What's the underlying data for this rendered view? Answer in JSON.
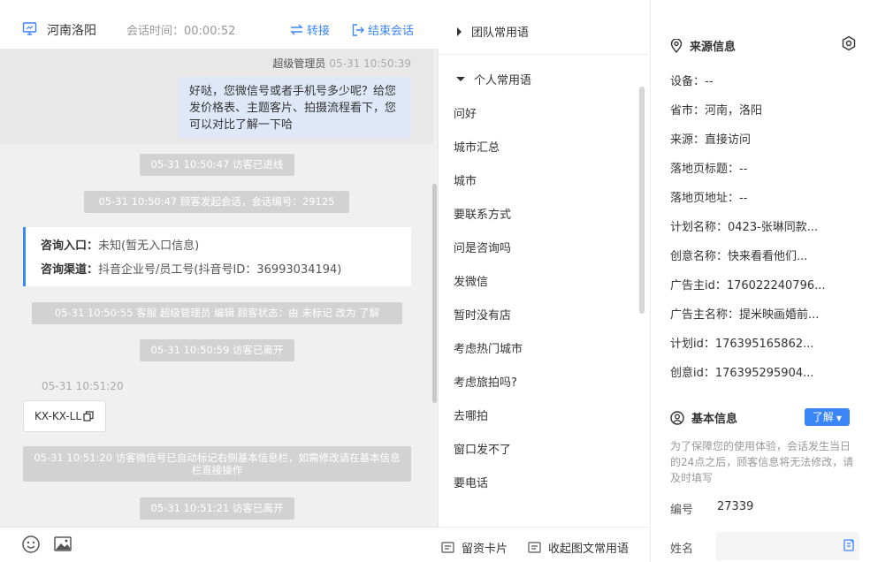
{
  "chat": {
    "header": {
      "location": "河南洛阳",
      "session_time": "会话时间：00:00:52",
      "transfer_label": "转接",
      "end_label": "结束会话"
    },
    "messages": {
      "agent_meta_name": "超级管理员",
      "agent_meta_time": "05-31 10:50:39",
      "agent_text": "好哒，您微信号或者手机号多少呢？给您发价格表、主题客片、拍摄流程看下，您可以对比了解一下哈",
      "sys1": "05-31 10:50:47 访客已进线",
      "sys2": "05-31 10:50:47 顾客发起会话，会话编号：29125",
      "entry_label": "咨询入口：",
      "entry_value": "未知(暂无入口信息)",
      "channel_label": "咨询渠道：",
      "channel_value": "抖音企业号/员工号(抖音号ID：36993034194)",
      "sys3": "05-31 10:50:55 客服 超级管理员 编辑 顾客状态：由 未标记 改为 了解",
      "sys4": "05-31 10:50:59 访客已离开",
      "visitor_time": "05-31 10:51:20",
      "visitor_text": "KX-KX-LL",
      "sys5": "05-31 10:51:20 访客微信号已自动标记右侧基本信息栏，如需修改请在基本信息栏直接操作",
      "sys6": "05-31 10:51:21 访客已离开"
    },
    "toolbar": {
      "emoji_icon": "smile-icon",
      "image_icon": "image-icon"
    }
  },
  "phrases": {
    "team_group": "团队常用语",
    "personal_group": "个人常用语",
    "items": [
      "问好",
      "城市汇总",
      "城市",
      "要联系方式",
      "问是咨询吗",
      "发微信",
      "暂时没有店",
      "考虑热门城市",
      "考虑旅拍吗?",
      "去哪拍",
      "窗口发不了",
      "要电话"
    ],
    "footer": {
      "card_label": "留资卡片",
      "collect_label": "收起图文常用语"
    }
  },
  "visitor": {
    "source_title": "来源信息",
    "fields": [
      "设备：--",
      "省市：河南，洛阳",
      "来源：直接访问",
      "落地页标题：--",
      "落地页地址：--",
      "计划名称：0423-张琳同款...",
      "创意名称：快来看看他们...",
      "广告主id：176022240796...",
      "广告主名称：提米映画婚前...",
      "计划id：176395165862...",
      "创意id：176395295904..."
    ],
    "basic_title": "基本信息",
    "learn_label": "了解",
    "notice": "为了保障您的使用体验，会话发生当日的24点之后，顾客信息将无法修改，请及时填写",
    "number_label": "编号",
    "number_value": "27339",
    "name_label": "姓名",
    "name_value": ""
  },
  "colors": {
    "accent": "#3b86f6",
    "pill": "#d2d2d2",
    "agent_bubble": "#dfe8f8"
  }
}
